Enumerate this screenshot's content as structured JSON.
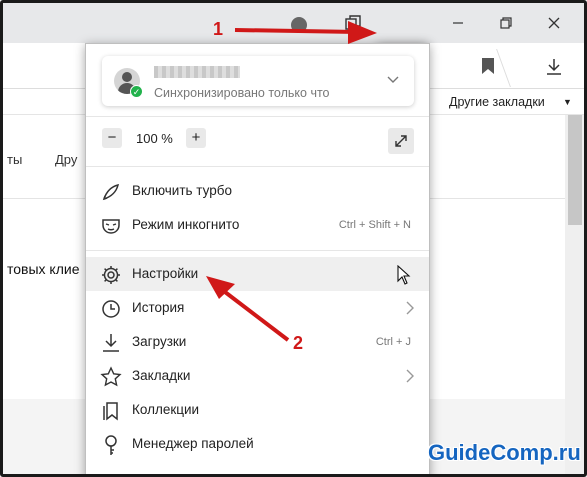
{
  "browser": {
    "bookmarks_bar": {
      "other_bookmarks": "Другие закладки"
    }
  },
  "page_behind": {
    "text_fragment_1": "ты",
    "text_fragment_2": "Дру",
    "text_fragment_3": "товых клие"
  },
  "menu": {
    "account": {
      "sync_status": "Синхронизировано только что"
    },
    "zoom": {
      "minus": "−",
      "value": "100 %",
      "plus": "+"
    },
    "items": [
      {
        "label": "Включить турбо",
        "icon": "rocket-icon",
        "hint": ""
      },
      {
        "label": "Режим инкогнито",
        "icon": "incognito-mask-icon",
        "hint": "Ctrl + Shift + N"
      },
      {
        "label": "Настройки",
        "icon": "gear-icon",
        "hint": ""
      },
      {
        "label": "История",
        "icon": "clock-icon",
        "hint": ""
      },
      {
        "label": "Загрузки",
        "icon": "download-icon",
        "hint": "Ctrl + J"
      },
      {
        "label": "Закладки",
        "icon": "star-icon",
        "hint": ""
      },
      {
        "label": "Коллекции",
        "icon": "collections-icon",
        "hint": ""
      },
      {
        "label": "Менеджер паролей",
        "icon": "key-icon",
        "hint": ""
      }
    ]
  },
  "annotations": {
    "step1": "1",
    "step2": "2",
    "color": "#d01818"
  },
  "watermark": "GuideComp.ru"
}
